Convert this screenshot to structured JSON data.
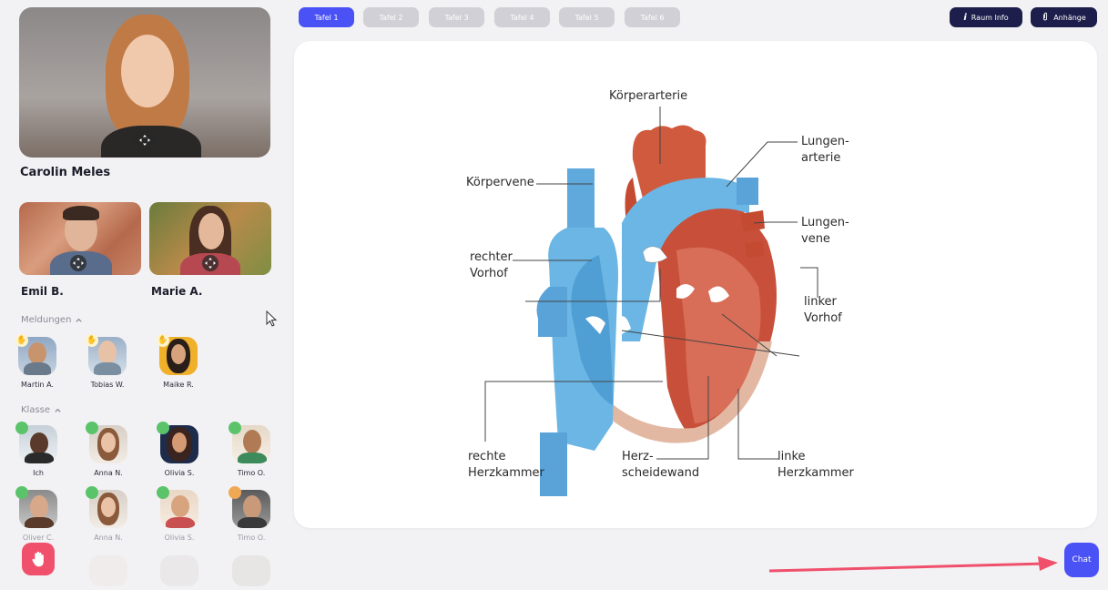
{
  "tabs": [
    "Tafel 1",
    "Tafel 2",
    "Tafel 3",
    "Tafel 4",
    "Tafel 5",
    "Tafel 6"
  ],
  "active_tab": 0,
  "top_actions": {
    "room_info": "Raum Info",
    "attachments": "Anhänge"
  },
  "presenter": {
    "name": "Carolin Meles"
  },
  "participants_video": [
    {
      "name": "Emil B."
    },
    {
      "name": "Marie A."
    }
  ],
  "sections": {
    "reports": "Meldungen",
    "class": "Klasse"
  },
  "reports": [
    {
      "name": "Martin A."
    },
    {
      "name": "Tobias W."
    },
    {
      "name": "Maike R."
    }
  ],
  "class_row1": [
    {
      "name": "Ich",
      "status": "online"
    },
    {
      "name": "Anna N.",
      "status": "online"
    },
    {
      "name": "Olivia S.",
      "status": "online"
    },
    {
      "name": "Timo O.",
      "status": "online"
    }
  ],
  "class_row2": [
    {
      "name": "Oliver C.",
      "status": "online"
    },
    {
      "name": "Anna N.",
      "status": "online"
    },
    {
      "name": "Olivia S.",
      "status": "online"
    },
    {
      "name": "Timo O.",
      "status": "away"
    }
  ],
  "diagram_labels": {
    "koerperarterie": "Körperarterie",
    "lungenarterie_1": "Lungen-",
    "lungenarterie_2": "arterie",
    "koerpervene": "Körpervene",
    "lungenvene_1": "Lungen-",
    "lungenvene_2": "vene",
    "rechter_vorhof_1": "rechter",
    "rechter_vorhof_2": "Vorhof",
    "linker_vorhof_1": "linker",
    "linker_vorhof_2": "Vorhof",
    "rechte_herzkammer_1": "rechte",
    "rechte_herzkammer_2": "Herzkammer",
    "herzscheidewand_1": "Herz-",
    "herzscheidewand_2": "scheidewand",
    "linke_herzkammer_1": "linke",
    "linke_herzkammer_2": "Herzkammer"
  },
  "chat_label": "Chat",
  "colors": {
    "accent": "#4a52f5",
    "dark": "#1d1e4c",
    "online": "#5bc36a",
    "away": "#f0a855",
    "raise": "#f0506b"
  }
}
